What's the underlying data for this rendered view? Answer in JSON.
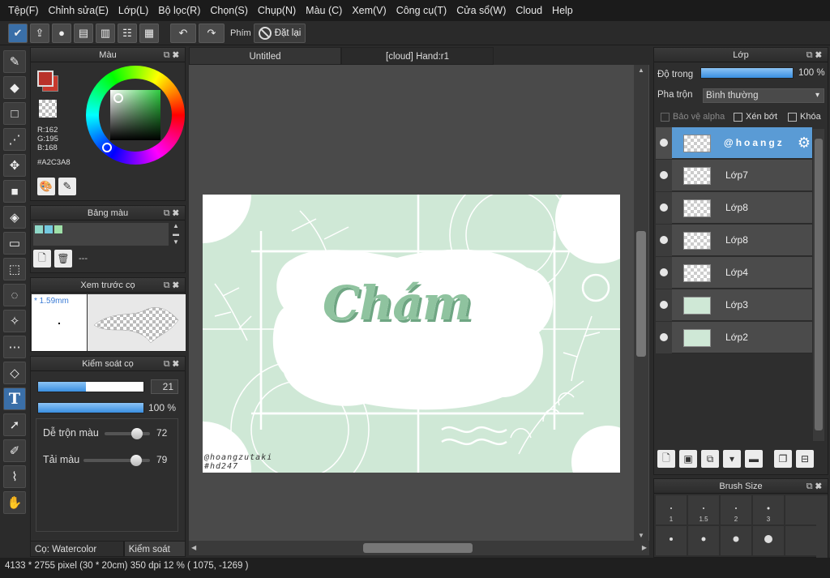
{
  "menu": [
    "Tệp(F)",
    "Chỉnh sửa(E)",
    "Lớp(L)",
    "Bộ lọc(R)",
    "Chọn(S)",
    "Chụp(N)",
    "Màu (C)",
    "Xem(V)",
    "Công cụ(T)",
    "Cửa sổ(W)",
    "Cloud",
    "Help"
  ],
  "toolbar": {
    "key_label": "Phím",
    "reset_label": "Đặt lại"
  },
  "color_panel": {
    "title": "Màu",
    "r": "R:162",
    "g": "G:195",
    "b": "B:168",
    "hex": "#A2C3A8",
    "fg_color": "#b9322a"
  },
  "palette_panel": {
    "title": "Bảng màu",
    "swatches": [
      "#8fd8c8",
      "#74c9e0",
      "#9fe0a8"
    ],
    "name": "---"
  },
  "preview_panel": {
    "title": "Xem trước cọ",
    "size": "* 1.59mm"
  },
  "brush_control": {
    "title": "Kiểm soát cọ",
    "size_value": "21",
    "size_fraction": 0.45,
    "opacity_value": "100 %",
    "opacity_fraction": 1.0,
    "blend_label": "Dễ trộn màu",
    "blend_value": "72",
    "blend_fraction": 0.72,
    "load_label": "Tải màu",
    "load_value": "79",
    "load_fraction": 0.79
  },
  "bottom_tabs": [
    "Cọ: Watercolor (Wet)",
    "Kiểm soát cọ"
  ],
  "doc_tabs": [
    "Untitled",
    "[cloud] Hand:r1"
  ],
  "artwork": {
    "title": "Chám",
    "signature_1": "@hoangzutaki",
    "signature_2": "#hd247"
  },
  "layer_panel": {
    "title": "Lớp",
    "opacity_label": "Độ trong",
    "opacity_value": "100 %",
    "blend_label": "Pha trộn",
    "blend_value": "Bình thường",
    "protect_alpha": "Bảo vệ alpha",
    "clipping": "Xén bớt",
    "lock": "Khóa",
    "layers": [
      {
        "name": "@hoangz",
        "selected": true,
        "thumb": "checker"
      },
      {
        "name": "Lớp7",
        "selected": false,
        "thumb": "checker"
      },
      {
        "name": "Lớp8",
        "selected": false,
        "thumb": "checker"
      },
      {
        "name": "Lớp8",
        "selected": false,
        "thumb": "checker"
      },
      {
        "name": "Lớp4",
        "selected": false,
        "thumb": "checker"
      },
      {
        "name": "Lớp3",
        "selected": false,
        "thumb": "green"
      },
      {
        "name": "Lớp2",
        "selected": false,
        "thumb": "green"
      }
    ]
  },
  "brush_size_panel": {
    "title": "Brush Size",
    "cells": [
      {
        "label": "1",
        "dot": 1
      },
      {
        "label": "1.5",
        "dot": 1.5
      },
      {
        "label": "2",
        "dot": 2
      },
      {
        "label": "3",
        "dot": 3
      },
      {
        "label": "",
        "dot": 0
      },
      {
        "label": "",
        "dot": 4
      },
      {
        "label": "",
        "dot": 5
      },
      {
        "label": "",
        "dot": 7
      },
      {
        "label": "",
        "dot": 10
      },
      {
        "label": "",
        "dot": 0
      }
    ]
  },
  "status": {
    "text": "4133 * 2755 pixel  (30 * 20cm)  350 dpi  12 %  ( 1075, -1269 )"
  },
  "icons": {
    "tools": [
      "brush-icon",
      "eraser-icon",
      "rectangle-icon",
      "dot-pen-icon",
      "move-icon",
      "fill-rect-icon",
      "bucket-icon",
      "gradient-icon",
      "rect-select-icon",
      "lasso-icon",
      "magic-wand-icon",
      "select-pen-icon",
      "select-eraser-icon",
      "text-icon",
      "operation-icon",
      "eyedropper-pen-icon",
      "eyedropper-icon",
      "hand-icon"
    ]
  }
}
